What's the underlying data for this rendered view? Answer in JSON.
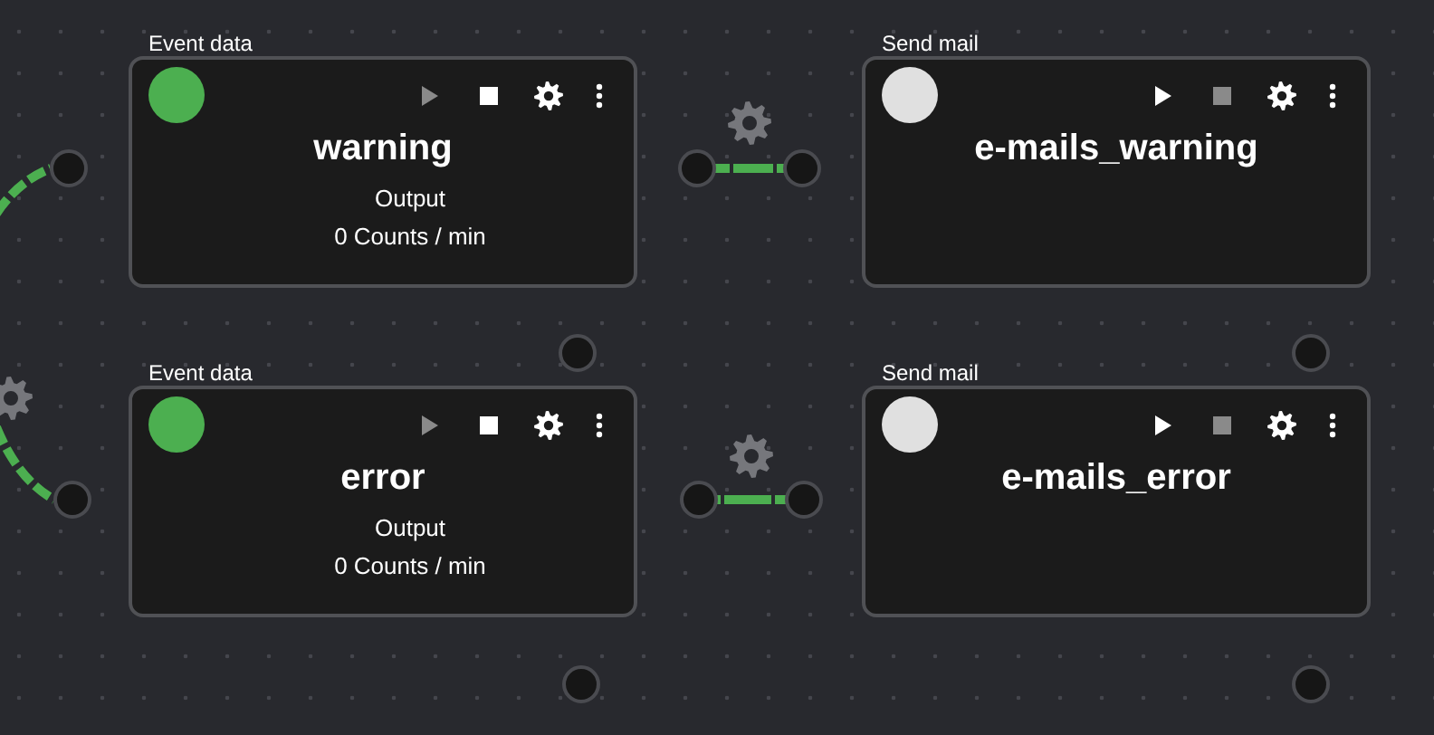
{
  "nodes": [
    {
      "category": "Event data",
      "title": "warning",
      "output_label": "Output",
      "output_value": "0 Counts / min",
      "running": true
    },
    {
      "category": "Send mail",
      "title": "e-mails_warning",
      "running": false
    },
    {
      "category": "Event data",
      "title": "error",
      "output_label": "Output",
      "output_value": "0 Counts / min",
      "running": true
    },
    {
      "category": "Send mail",
      "title": "e-mails_error",
      "running": false
    }
  ]
}
